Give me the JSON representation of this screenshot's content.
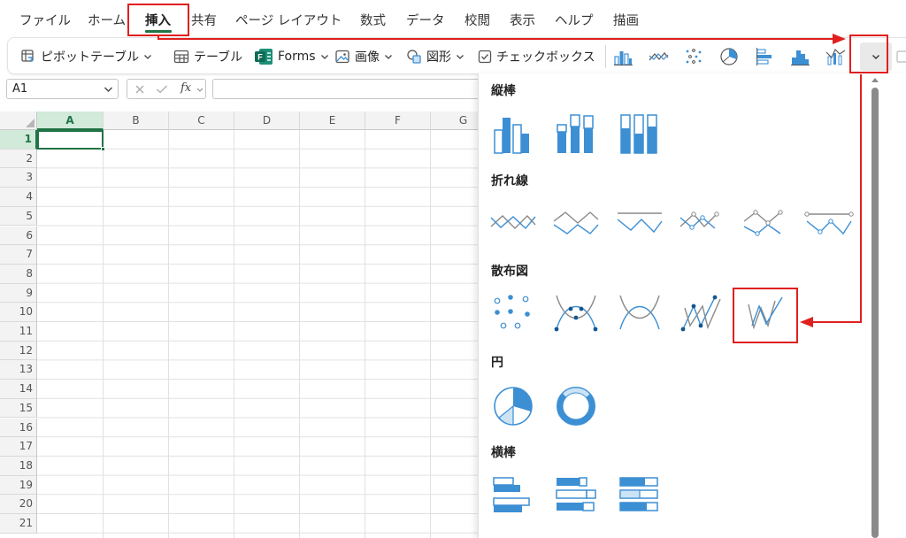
{
  "menu": {
    "tabs": [
      {
        "label": "ファイル"
      },
      {
        "label": "ホーム"
      },
      {
        "label": "挿入"
      },
      {
        "label": "共有"
      },
      {
        "label": "ページ レイアウト"
      },
      {
        "label": "数式"
      },
      {
        "label": "データ"
      },
      {
        "label": "校閲"
      },
      {
        "label": "表示"
      },
      {
        "label": "ヘルプ"
      },
      {
        "label": "描画"
      }
    ],
    "active_tab": "挿入"
  },
  "ribbon": {
    "pivot_table": "ピボットテーブル",
    "table": "テーブル",
    "forms": "Forms",
    "image": "画像",
    "shapes": "図形",
    "checkbox": "チェックボックス"
  },
  "formula_bar": {
    "name_box": "A1",
    "fx_label": "fx",
    "formula": ""
  },
  "grid": {
    "columns": [
      "A",
      "B",
      "C",
      "D",
      "E",
      "F",
      "G"
    ],
    "rows": [
      "1",
      "2",
      "3",
      "4",
      "5",
      "6",
      "7",
      "8",
      "9",
      "10",
      "11",
      "12",
      "13",
      "14",
      "15",
      "16",
      "17",
      "18",
      "19",
      "20",
      "21"
    ],
    "selected_cell": "A1"
  },
  "chart_panel": {
    "sections": [
      {
        "title": "縦棒"
      },
      {
        "title": "折れ線"
      },
      {
        "title": "散布図"
      },
      {
        "title": "円"
      },
      {
        "title": "横棒"
      }
    ]
  },
  "colors": {
    "accent_green": "#217346",
    "chart_blue": "#3d8fd4",
    "chart_light": "#cce3f6",
    "annotation_red": "#e01f1f"
  }
}
